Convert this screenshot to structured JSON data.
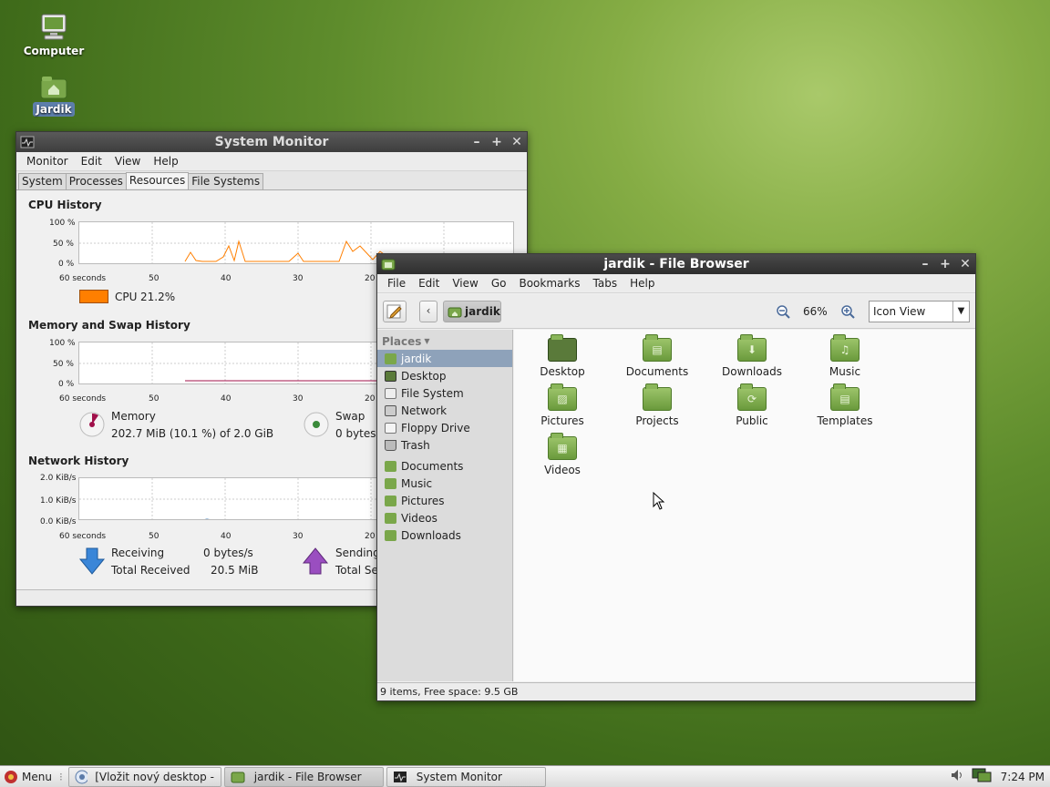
{
  "desktop": {
    "icons": [
      {
        "label": "Computer"
      },
      {
        "label": "Jardik"
      }
    ]
  },
  "sysmon": {
    "title": "System Monitor",
    "menu": [
      "Monitor",
      "Edit",
      "View",
      "Help"
    ],
    "tabs": [
      "System",
      "Processes",
      "Resources",
      "File Systems"
    ],
    "selected_tab": "Resources",
    "cpu": {
      "title": "CPU History",
      "y_ticks": [
        "100 %",
        "50 %",
        "0 %"
      ],
      "x_ticks": [
        "60 seconds",
        "50",
        "40",
        "30",
        "20"
      ],
      "legend_label": "CPU",
      "legend_value": "21.2%",
      "color": "#ff7f00"
    },
    "mem": {
      "title": "Memory and Swap History",
      "y_ticks": [
        "100 %",
        "50 %",
        "0 %"
      ],
      "x_ticks": [
        "60 seconds",
        "50",
        "40",
        "30",
        "20"
      ],
      "memory_label": "Memory",
      "memory_value": "202.7 MiB (10.1 %) of 2.0 GiB",
      "swap_label": "Swap",
      "swap_value": "0 bytes",
      "memory_color": "#a0104a",
      "swap_color": "#3a8a3a"
    },
    "net": {
      "title": "Network History",
      "y_ticks": [
        "2.0 KiB/s",
        "1.0 KiB/s",
        "0.0 KiB/s"
      ],
      "x_ticks": [
        "60 seconds",
        "50",
        "40",
        "30",
        "20"
      ],
      "receiving_label": "Receiving",
      "receiving_value": "0 bytes/s",
      "total_received_label": "Total Received",
      "total_received_value": "20.5 MiB",
      "sending_label": "Sending",
      "total_sent_label": "Total Se"
    }
  },
  "filebrowser": {
    "title": "jardik - File Browser",
    "menu": [
      "File",
      "Edit",
      "View",
      "Go",
      "Bookmarks",
      "Tabs",
      "Help"
    ],
    "location": "jardik",
    "zoom": "66%",
    "view_mode": "Icon View",
    "places_header": "Places",
    "places": [
      {
        "label": "jardik",
        "icon": "home-icon"
      },
      {
        "label": "Desktop",
        "icon": "desktop-icon"
      },
      {
        "label": "File System",
        "icon": "drive-icon"
      },
      {
        "label": "Network",
        "icon": "network-icon"
      },
      {
        "label": "Floppy Drive",
        "icon": "floppy-icon"
      },
      {
        "label": "Trash",
        "icon": "trash-icon"
      }
    ],
    "bookmarks": [
      {
        "label": "Documents"
      },
      {
        "label": "Music"
      },
      {
        "label": "Pictures"
      },
      {
        "label": "Videos"
      },
      {
        "label": "Downloads"
      }
    ],
    "files": [
      {
        "label": "Desktop",
        "glyph": ""
      },
      {
        "label": "Documents",
        "glyph": "▤"
      },
      {
        "label": "Downloads",
        "glyph": "⬇"
      },
      {
        "label": "Music",
        "glyph": "♫"
      },
      {
        "label": "Pictures",
        "glyph": "▨"
      },
      {
        "label": "Projects",
        "glyph": ""
      },
      {
        "label": "Public",
        "glyph": "⟳"
      },
      {
        "label": "Templates",
        "glyph": "▤"
      },
      {
        "label": "Videos",
        "glyph": "▦"
      }
    ],
    "status": "9 items, Free space: 9.5 GB"
  },
  "taskbar": {
    "menu_label": "Menu",
    "tasks": [
      {
        "label": "[Vložit nový desktop - ..."
      },
      {
        "label": "jardik - File Browser"
      },
      {
        "label": "System Monitor"
      }
    ],
    "clock": "7:24 PM"
  }
}
